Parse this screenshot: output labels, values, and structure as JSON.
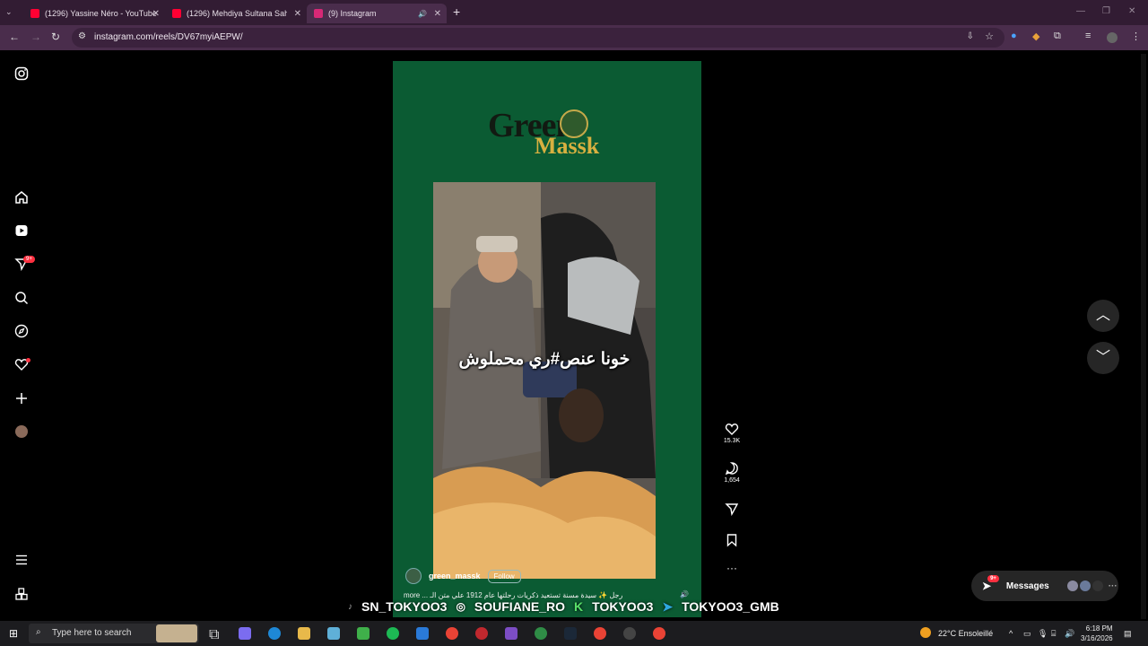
{
  "browser": {
    "tabs": [
      {
        "label": "(1296) Yassine Néro - YouTube",
        "fav": "#ff0033"
      },
      {
        "label": "(1296) Mehdiya Sultana Saha Ya",
        "fav": "#ff0033"
      },
      {
        "label": "(9) Instagram",
        "fav": "#d62976"
      }
    ],
    "url": "instagram.com/reels/DV67myiAEPW/"
  },
  "sidebar": {
    "notif_badge": "9+"
  },
  "reel": {
    "logo_top": "Green",
    "logo_bottom": "Massk",
    "caption": "خونا عنص#ري محملوش",
    "likes": "15.3K",
    "comments": "1,654",
    "username": "green_massk",
    "follow": "Follow",
    "description": "more ... رجل ✨ سيدة مسنة تستعيد ذكريات رحلتها عام 1912 علي متن الـ",
    "watermarks": [
      "SN_TOKYOO3",
      "SOUFIANE_RO",
      "TOKYOO3",
      "TOKYOO3_GMB"
    ]
  },
  "messages": {
    "label": "Messages",
    "badge": "9+"
  },
  "taskbar": {
    "search_placeholder": "Type here to search",
    "weather": "22°C  Ensoleillé",
    "time": "6:18 PM",
    "date": "3/16/2026"
  },
  "icons": [
    "instagram-icon",
    "home-icon",
    "reels-icon",
    "direct-icon",
    "search-icon",
    "explore-icon",
    "heart-icon",
    "create-icon",
    "menu-icon",
    "more-icon"
  ]
}
